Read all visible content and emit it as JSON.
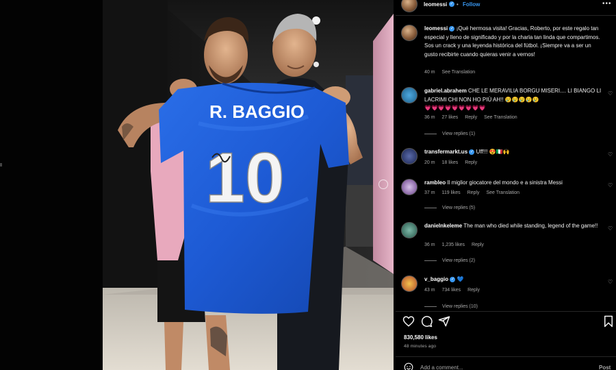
{
  "post": {
    "username": "leomessi",
    "follow_label": "Follow",
    "more_label": "•••",
    "caption": "¡Qué hermosa visita! Gracias, Roberto, por este regalo tan especial y lleno de significado y por la charla tan linda que compartimos. Sos un crack y una leyenda histórica del fútbol. ¡Siempre va a ser un gusto recibirte cuando quieras venir a vernos!",
    "caption_time": "40 m",
    "caption_translation": "See Translation",
    "likes": "830,580 likes",
    "time_ago": "48 minutes ago",
    "add_comment_placeholder": "Add a comment...",
    "post_label": "Post",
    "jersey_name": "R. BAGGIO",
    "jersey_number": "10"
  },
  "comments": [
    {
      "username": "gabriel.abrahem",
      "text": "CHE LE MERAVILIA BORGU MISERI.... LI BIANGO LI LACRIMI CHI NON HO PIÙ AH!! 😢😢😢😢😢",
      "text2": "💗💗💗💗💗💗💗💗💗",
      "time": "36 m",
      "likes": "27 likes",
      "reply": "Reply",
      "translation": "See Translation",
      "view_replies": "View replies (1)"
    },
    {
      "username": "transfermarkt.us",
      "text": "Uff!!! 😍🇮🇹🙌",
      "time": "20 m",
      "likes": "18 likes",
      "reply": "Reply"
    },
    {
      "username": "rambleo",
      "text": "Il miglior giocatore del mondo e a sinistra Messi",
      "time": "37 m",
      "likes": "119 likes",
      "reply": "Reply",
      "translation": "See Translation",
      "view_replies": "View replies (5)"
    },
    {
      "username": "danielnkeleme",
      "text": "The man who died while standing, legend of the game!!",
      "time": "36 m",
      "likes": "1,235 likes",
      "reply": "Reply",
      "view_replies": "View replies (2)"
    },
    {
      "username": "v_baggio",
      "text": "💙",
      "time": "43 m",
      "likes": "734 likes",
      "reply": "Reply",
      "view_replies": "View replies (10)"
    }
  ],
  "icons": {
    "heart": "heart-icon",
    "comment": "comment-icon",
    "share": "share-icon",
    "save": "bookmark-icon",
    "verified": "verified-badge-icon",
    "more": "more-options-icon",
    "emoji": "emoji-icon"
  },
  "colors": {
    "accent": "#3897f0",
    "jersey": "#1e5bd6",
    "panel_bg": "#000000"
  }
}
